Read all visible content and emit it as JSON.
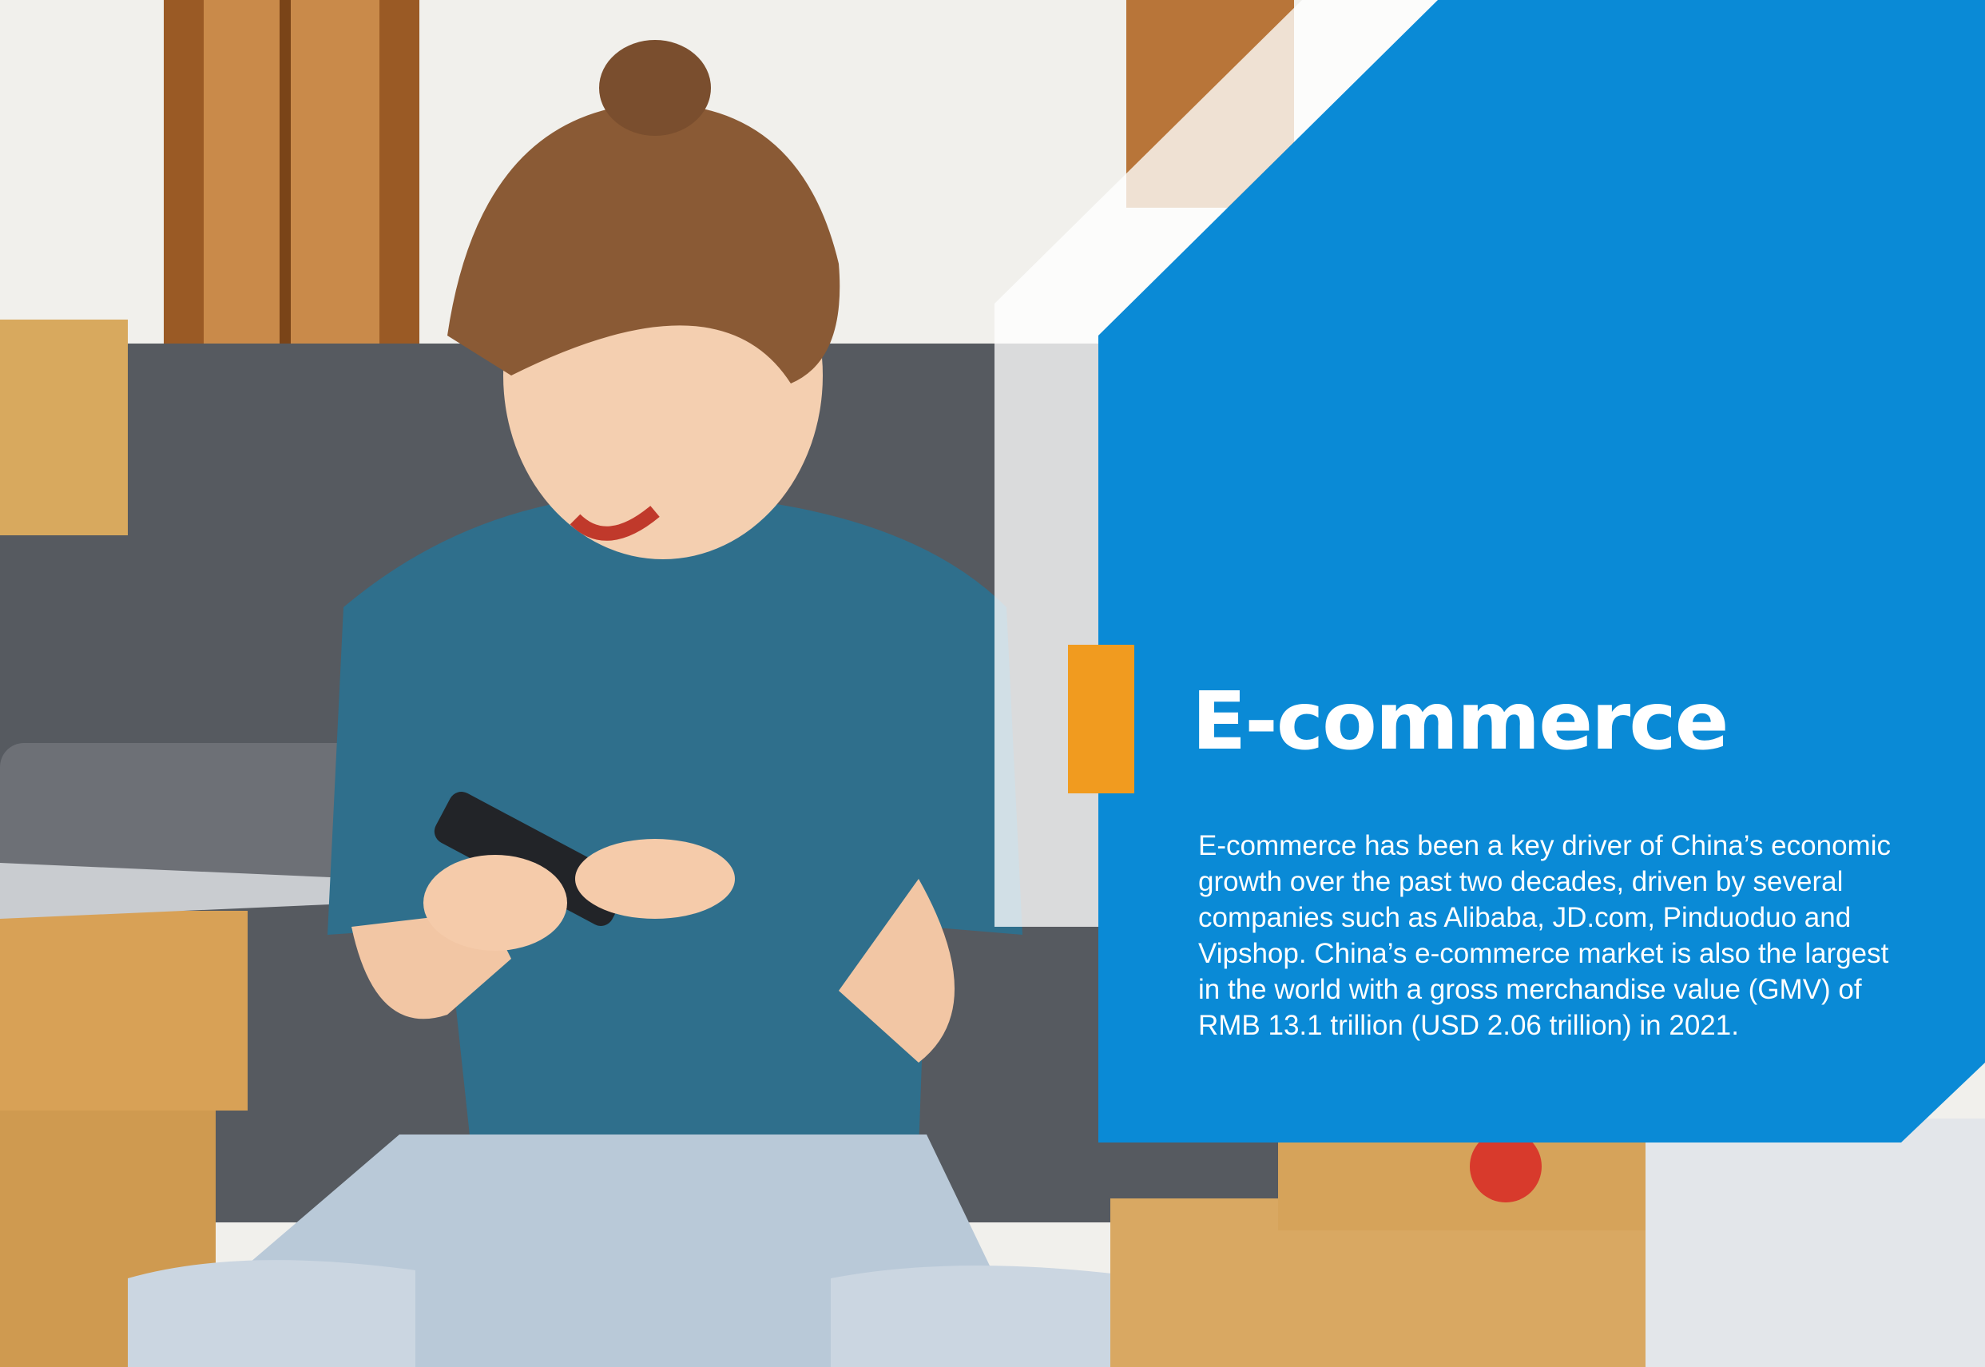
{
  "page": {
    "title": "E-commerce",
    "body": "E-commerce has been a key driver of China’s economic growth over the past two decades, driven by several companies such as Alibaba, JD.com, Pinduoduo and Vipshop. China’s e-commerce market is also the largest in the world with a gross merchandise value (GMV) of RMB 13.1 trillion (USD 2.06 trillion) in 2021."
  },
  "colors": {
    "panel": "#0A8AD6",
    "accent": "#F19B1F",
    "text": "#FFFFFF"
  },
  "photo": {
    "description_icon": "photo-woman-phone-icon"
  }
}
